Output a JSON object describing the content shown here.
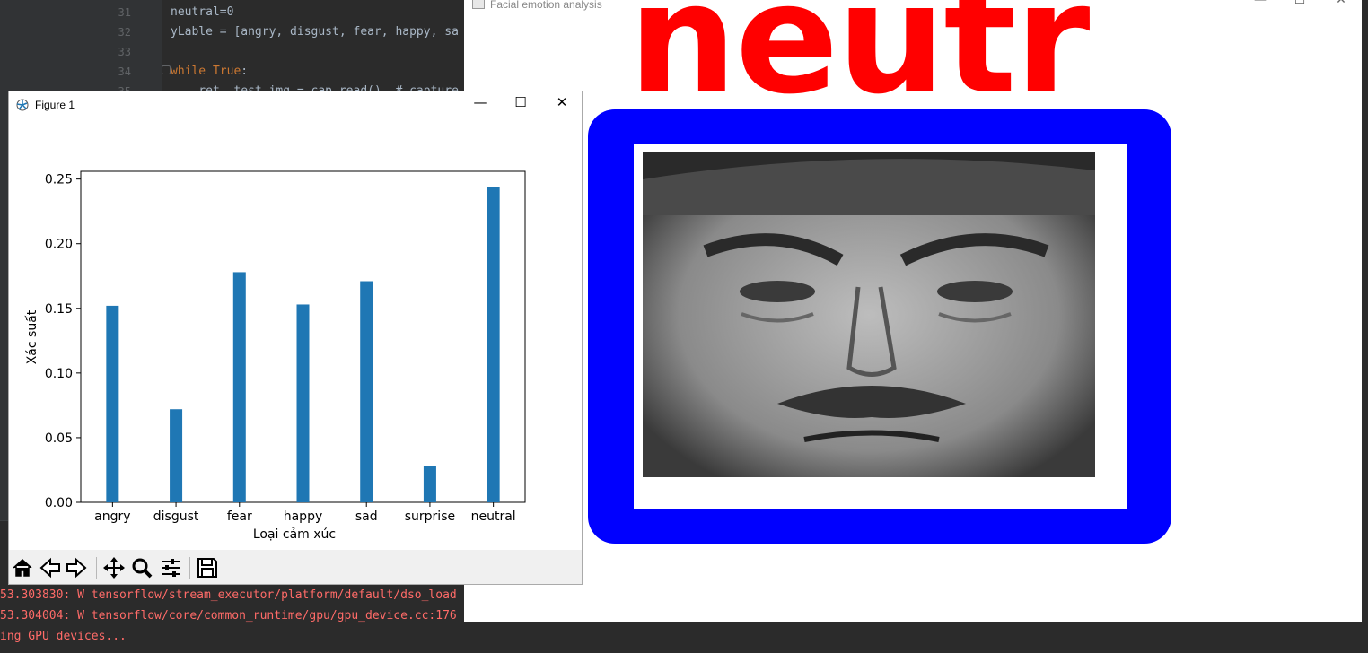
{
  "ide": {
    "lines": [
      {
        "num": "31",
        "text": "neutral=0"
      },
      {
        "num": "32",
        "text": "yLable = [angry, disgust, fear, happy, sa"
      },
      {
        "num": "33",
        "text": ""
      },
      {
        "num": "34",
        "kw": "while",
        "kw2": "True",
        "rest": ":"
      },
      {
        "num": "35",
        "text": "    ret, test_img = cap.read()  # capture"
      }
    ],
    "console": [
      "53.303830: W tensorflow/stream_executor/platform/default/dso_load",
      "53.304004: W tensorflow/core/common_runtime/gpu/gpu_device.cc:176",
      "ing GPU devices..."
    ]
  },
  "emotion_window": {
    "title": "Facial emotion analysis",
    "label": "neutr",
    "minimize": "—",
    "maximize": "☐",
    "close": "✕"
  },
  "figure": {
    "title": "Figure 1",
    "minimize": "—",
    "maximize": "☐",
    "close": "✕",
    "toolbar": [
      "home-icon",
      "back-icon",
      "forward-icon",
      "pan-icon",
      "zoom-icon",
      "configure-icon",
      "save-icon"
    ]
  },
  "chart_data": {
    "type": "bar",
    "categories": [
      "angry",
      "disgust",
      "fear",
      "happy",
      "sad",
      "surprise",
      "neutral"
    ],
    "values": [
      0.152,
      0.072,
      0.178,
      0.153,
      0.171,
      0.028,
      0.244
    ],
    "xlabel": "Loại cảm xúc",
    "ylabel": "Xác suất",
    "yticks": [
      "0.00",
      "0.05",
      "0.10",
      "0.15",
      "0.20",
      "0.25"
    ],
    "ylim": [
      0,
      0.256
    ],
    "color": "#1f77b4",
    "grid": false
  }
}
